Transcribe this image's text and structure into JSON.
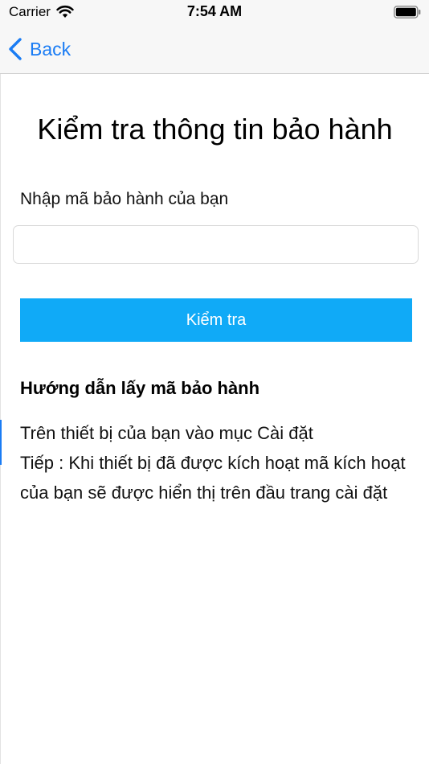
{
  "status_bar": {
    "carrier": "Carrier",
    "time": "7:54 AM",
    "wifi_icon": "wifi-icon",
    "battery_icon": "battery-icon"
  },
  "nav": {
    "back_label": "Back",
    "back_icon": "chevron-left-icon",
    "tint_color": "#1a7cf4"
  },
  "main": {
    "title": "Kiểm tra thông tin bảo hành",
    "input_label": "Nhập mã bảo hành của bạn",
    "input_value": "",
    "input_placeholder": "",
    "check_button_label": "Kiểm tra",
    "button_color": "#10aaf7",
    "guide": {
      "heading": "Hướng dẫn lấy mã bảo hành",
      "line1": "Trên thiết bị của bạn vào mục Cài đặt",
      "line2": "Tiếp : Khi thiết bị đã được kích hoạt mã kích hoạt của bạn sẽ được hiển thị trên đầu trang cài đặt"
    }
  }
}
